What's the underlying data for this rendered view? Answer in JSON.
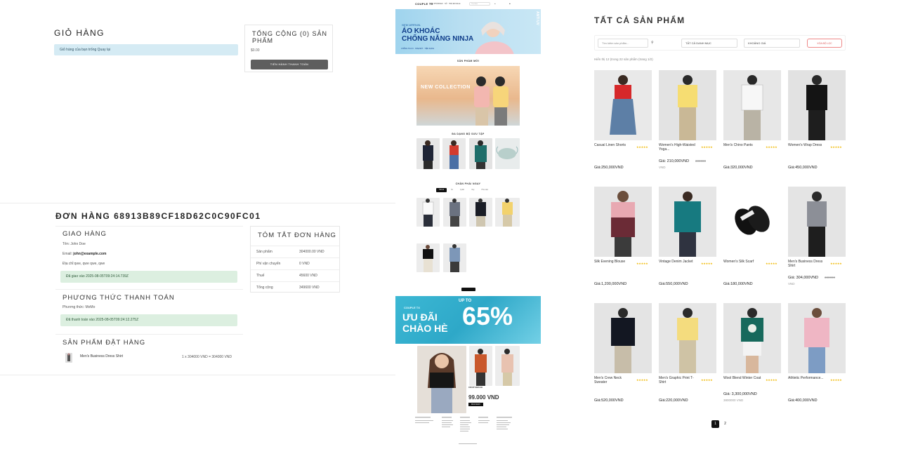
{
  "cart": {
    "title": "GIỎ HÀNG",
    "empty_msg": "Giỏ hàng của bạn trống Quay lại",
    "summary_title": "TỔNG CỘNG (0) SẢN PHẨM",
    "summary_total": "$0.00",
    "checkout_label": "TIẾN HÀNH THANH TOÁN"
  },
  "order": {
    "title": "ĐƠN HÀNG 68913B89CF18D62C0C90FC01",
    "shipping_title": "GIAO HÀNG",
    "name_line": "Tên: John Doe",
    "email_label": "Email:",
    "email_value": "john@example.com",
    "address_line": "Địa chỉ:qwe, qwe qwe, qwe",
    "delivered_msg": "Đã giao vào 2025-08-05T09:24:14.739Z",
    "payment_title": "PHƯƠNG THỨC THANH TOÁN",
    "method_line": "Phương thức: MoMo",
    "paid_msg": "Đã thanh toán vào 2025-08-05T09:24:12.275Z",
    "items_title": "SẢN PHẨM ĐẶT HÀNG",
    "item_name": "Men's Business Dress Shirt",
    "item_calc": "1 x 304000 VND = 304000 VND",
    "summary_title": "TÓM TẮT ĐƠN HÀNG",
    "summary_rows": [
      {
        "k": "Sản phẩm",
        "v": "304000.00 VND"
      },
      {
        "k": "Phí vận chuyển",
        "v": "0 VND"
      },
      {
        "k": "Thuế",
        "v": "45600 VND"
      },
      {
        "k": "Tổng cộng",
        "v": "349600 VND"
      }
    ]
  },
  "home": {
    "logo": "COUPLE TX",
    "nav_links": [
      "SẢN PHẨM",
      "NAM",
      "NỮ",
      "TRẺ EM",
      "SALE"
    ],
    "search_placeholder": "Tìm kiếm",
    "hero_sub": "NEW ARRIVAL",
    "hero_title_1": "ÁO KHOÁC",
    "hero_title_2": "CHỐNG NẮNG NINJA",
    "hero_badges": "CHỐNG TIA UV  ·  NHẸ MÁT  ·  TIỆN DỤNG",
    "hero_side": "ANTI UV",
    "new_products_heading": "SẢN PHẨM MỚI",
    "new_collection": "NEW COLLECTION",
    "collections_heading": "ĐA DẠNG BỘ SƯU TẬP",
    "hot_heading": "CHÂN PHÁI NGAY",
    "tabs": [
      "Tất cả",
      "Áo",
      "Quần",
      "Váy",
      "Phụ kiện"
    ],
    "promo_brand": "COUPLE TX",
    "promo_line1": "ƯU ĐÃI",
    "promo_line2": "CHÀO HÈ",
    "promo_upto": "UP TO",
    "promo_pct": "65%",
    "deal_name": "CROP ĐEN 99",
    "deal_price": "99.000 VND",
    "deal_btn": "MUA NGAY"
  },
  "products": {
    "title": "TẤT CẢ SẢN PHẨM",
    "search_placeholder": "Tìm kiếm sản phẩm...",
    "category_select": "TẤT CẢ DANH MỤC",
    "price_select": "KHOẢNG GIÁ",
    "clear_btn": "XÓA BỘ LỌC",
    "results_text": "Hiển thị 12 (trong 22 sản phẩm (trang 1/2)",
    "stars": "★★★★★",
    "items": [
      {
        "name": "Casual Linen Shorts",
        "price": "Giá:250,000VND"
      },
      {
        "name": "Women's High-Waisted Yoga...",
        "price": "Giá: 210,000VND",
        "old": "300000",
        "old2": "VND"
      },
      {
        "name": "Men's Chino Pants",
        "price": "Giá:320,000VND"
      },
      {
        "name": "Women's Wrap Dress",
        "price": "Giá:450,000VND"
      },
      {
        "name": "Silk Evening Blouse",
        "price": "Giá:1,200,000VND"
      },
      {
        "name": "Vintage Denim Jacket",
        "price": "Giá:550,000VND"
      },
      {
        "name": "Women's Silk Scarf",
        "price": "Giá:180,000VND"
      },
      {
        "name": "Men's Business Dress Shirt",
        "price": "Giá: 304,000VND",
        "old": "380000",
        "old2": "VND"
      },
      {
        "name": "Men's Crew Neck Sweater",
        "price": "Giá:520,000VND"
      },
      {
        "name": "Men's Graphic Print T-Shirt",
        "price": "Giá:220,000VND"
      },
      {
        "name": "Wool Blend Winter Coat",
        "price": "Giá: 3,300,000VND",
        "old": "3800000 VND"
      },
      {
        "name": "Athletic Performance...",
        "price": "Giá:400,000VND"
      }
    ],
    "pages": [
      "1",
      "2"
    ]
  }
}
